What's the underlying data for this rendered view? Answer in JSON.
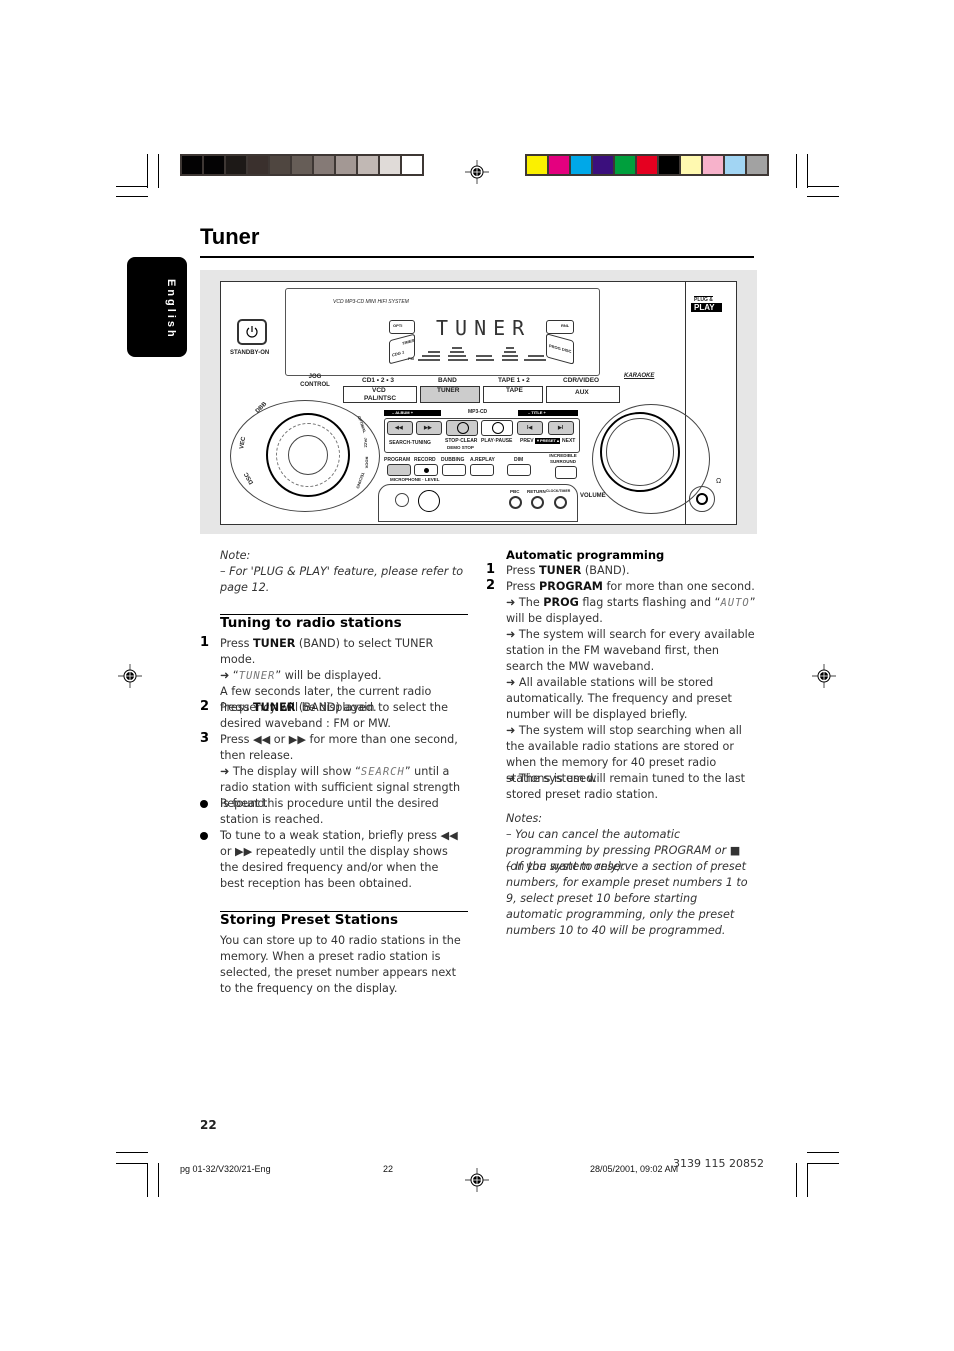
{
  "colors": {
    "grayscale": [
      "#030203",
      "#040304",
      "#1d1917",
      "#3a302d",
      "#4f4640",
      "#665d57",
      "#857a76",
      "#a39894",
      "#c1b8b4",
      "#e0dbd8",
      "#ffffff"
    ],
    "process": [
      "#fbf000",
      "#e4007f",
      "#00a8e8",
      "#3b0f7d",
      "#009f3d",
      "#e50020",
      "#000000",
      "#fff9b0",
      "#f7b2cb",
      "#a2d5f3",
      "#a2a2a2"
    ],
    "bar_border": "#3e3734",
    "illustration_bg": "#e6e6e6"
  },
  "page": {
    "title": "Tuner",
    "language_tab": "English",
    "page_number": "22"
  },
  "device": {
    "brand_line": "VCD MP3-CD MINI HIFI SYSTEM",
    "plug_play_top": "PLUG &",
    "plug_play_bottom": "PLAY",
    "standby_label": "STANDBY-ON",
    "display_text": "TUNER",
    "display_flags": {
      "opti": "OPTI",
      "timer": "TIMER",
      "cdg": "CDG 1",
      "fm": "FM",
      "rnl": "RNL",
      "prog": "PROG DISC"
    },
    "jog_label": "JOG CONTROL",
    "karaoke_logo": "KARAOKE",
    "source_buttons": [
      {
        "top": "CD1 • 2 • 3",
        "btn": "VCD",
        "sub": "PAL/NTSC"
      },
      {
        "top": "BAND",
        "btn": "TUNER",
        "sub": ""
      },
      {
        "top": "TAPE 1 • 2",
        "btn": "TAPE",
        "sub": ""
      },
      {
        "top": "CDR/VIDEO",
        "btn": "AUX",
        "sub": ""
      }
    ],
    "dsp_labels": [
      "DBB",
      "VEC",
      "DSC"
    ],
    "eq_labels": [
      "OPTIMAL",
      "JAZZ",
      "ROCK",
      "TECHNO"
    ],
    "album_label": "– ALBUM +",
    "mp3cd_label": "MP3-CD",
    "title_label": "– TITLE +",
    "transport": {
      "rew": "◀◀",
      "ff": "▶▶",
      "stop": "■",
      "play": "▶II",
      "prev": "I◀",
      "next": "▶I"
    },
    "transport_labels": {
      "search": "SEARCH-TUNING",
      "stop": "STOP·CLEAR",
      "demo": "DEMO STOP",
      "play": "PLAY·PAUSE",
      "prev": "PREV",
      "preset": "▼PRESET▲",
      "next": "NEXT"
    },
    "function_buttons": [
      "PROGRAM",
      "RECORD",
      "DUBBING",
      "A.REPLAY",
      "DIM"
    ],
    "incredible": "INCREDIBLE SURROUND",
    "mic_level": "MICROPHONE · LEVEL",
    "pbc": "PBC",
    "return": "RETURN",
    "clock": "CLOCK/TIMER",
    "volume": "VOLUME",
    "headphone": "Ω"
  },
  "left_column": {
    "note_title": "Note:",
    "note_text": "–  For 'PLUG & PLAY' feature, please refer to page 12.",
    "section1_title": "Tuning to radio stations",
    "steps": [
      {
        "n": "1",
        "pre": "Press ",
        "bold": "TUNER",
        "post": " (BAND) to select TUNER mode."
      },
      {
        "n": "2",
        "pre": "Press ",
        "bold": "TUNER",
        "post": " (BAND) again to select the desired waveband : FM or MW."
      },
      {
        "n": "3",
        "pre": "Press ◀◀ or ▶▶ for more than one second, then release.",
        "bold": "",
        "post": ""
      }
    ],
    "step1_arrow_pre": "➜ “",
    "step1_lcd": "TUNER",
    "step1_arrow_post": "” will be displayed.",
    "step1_extra": "A few seconds later, the current radio frequency will be displayed.",
    "step3_arrow_pre": "➜ The display will show “",
    "step3_lcd": "SEARCH",
    "step3_arrow_post": "” until a radio station with sufficient signal strength is found.",
    "bullets": [
      "Repeat this procedure until the desired station is reached.",
      "To tune to a weak station, briefly press  ◀◀ or ▶▶ repeatedly until the display shows the desired frequency and/or when the best reception has been obtained."
    ],
    "section2_title": "Storing Preset Stations",
    "section2_text": "You can store up to 40 radio stations in the memory. When a preset radio station is selected, the preset number appears next to the frequency on the display."
  },
  "right_column": {
    "title": "Automatic programming",
    "step1": {
      "n": "1",
      "pre": "Press ",
      "bold": "TUNER",
      "post": " (BAND)."
    },
    "step2": {
      "n": "2",
      "pre": "Press ",
      "bold": "PROGRAM",
      "post": " for more than one second."
    },
    "arrow1_pre": "➜ The ",
    "arrow1_bold": "PROG",
    "arrow1_mid": " flag starts flashing and “",
    "arrow1_lcd": "AUTO",
    "arrow1_post": "” will be displayed.",
    "arrows": [
      "➜ The system will search for every available station in the FM waveband first, then search the MW waveband.",
      "➜ All available stations will be stored automatically. The frequency and preset number will be displayed briefly.",
      "➜ The system  will stop searching when all the available radio stations are stored or when the memory for 40 preset radio stations is used.",
      "➜ The system will remain tuned to the last stored preset radio station."
    ],
    "notes_title": "Notes:",
    "notes": [
      "–  You can cancel the automatic programming by pressing PROGRAM or  ■  (on the system only).",
      "–  If you want to reserve a section of  preset numbers, for example preset numbers 1 to 9, select preset 10 before starting automatic programming, only the preset numbers 10 to 40 will be programmed."
    ]
  },
  "footer": {
    "file": "pg 01-32/V320/21-Eng",
    "page": "22",
    "date": "28/05/2001, 09:02 AM",
    "code": "3139 115 20852"
  }
}
